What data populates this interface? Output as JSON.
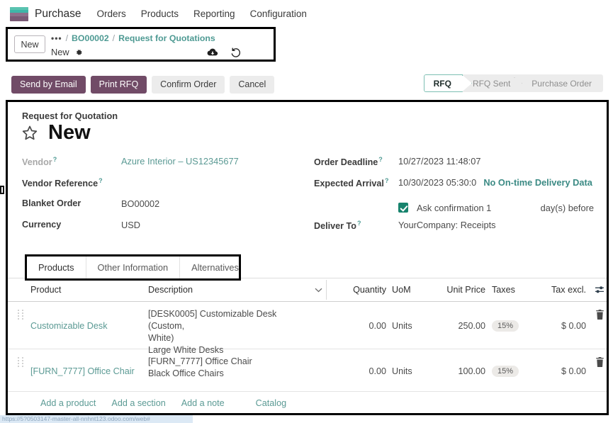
{
  "navbar": {
    "brand": "Purchase",
    "logo_icon": "purchase-app-logo-icon",
    "menus": [
      "Orders",
      "Products",
      "Reporting",
      "Configuration"
    ]
  },
  "breadcrumb": {
    "new_button": "New",
    "dots": "•••",
    "separator": "/",
    "parent_link": "BO00002",
    "current_link": "Request for Quotations",
    "record_state": "New",
    "gear_icon": "gear-icon",
    "save_icon": "cloud-save-icon",
    "discard_icon": "discard-undo-icon"
  },
  "action_buttons": [
    {
      "label": "Send by Email",
      "style": "primary"
    },
    {
      "label": "Print RFQ",
      "style": "primary"
    },
    {
      "label": "Confirm Order",
      "style": "secondary"
    },
    {
      "label": "Cancel",
      "style": "secondary"
    }
  ],
  "pipeline": {
    "steps": [
      "RFQ",
      "RFQ Sent",
      "Purchase Order"
    ],
    "active": "RFQ",
    "active_color": "#7dbfb3"
  },
  "form": {
    "subtitle": "Request for Quotation",
    "title": "New",
    "star_icon": "favorite-star-icon",
    "left_fields": [
      {
        "label": "Vendor",
        "help": "?",
        "value": "Azure Interior – US12345677",
        "kind": "link",
        "muted_label": true
      },
      {
        "label": "Vendor Reference",
        "help": "?",
        "value": "",
        "kind": "text",
        "muted_label": false
      },
      {
        "label": "Blanket Order",
        "help": "",
        "value": "BO00002",
        "kind": "text",
        "muted_label": false
      },
      {
        "label": "Currency",
        "help": "",
        "value": "USD",
        "kind": "text",
        "muted_label": false
      }
    ],
    "right_fields": [
      {
        "label": "Order Deadline",
        "help": "?",
        "value": "10/27/2023 11:48:07",
        "kind": "text"
      },
      {
        "label": "Expected Arrival",
        "help": "?",
        "value": "10/30/2023 05:30:0",
        "kind": "text",
        "extra_link": "No On-time Delivery Data"
      },
      {
        "label": "Deliver To",
        "help": "?",
        "value": "YourCompany: Receipts",
        "kind": "text"
      }
    ],
    "ask_confirmation": {
      "checked": true,
      "label": "Ask confirmation 1",
      "suffix": "day(s) before",
      "checkbox_color": "#17836d"
    }
  },
  "tabs": [
    {
      "label": "Products",
      "active": true
    },
    {
      "label": "Other Information",
      "active": false
    },
    {
      "label": "Alternatives",
      "active": false
    }
  ],
  "order_lines": {
    "columns": {
      "product": "Product",
      "description": "Description",
      "quantity": "Quantity",
      "uom": "UoM",
      "unit_price": "Unit Price",
      "taxes": "Taxes",
      "tax_excl": "Tax excl.",
      "caret_icon": "chevron-down-icon",
      "settings_icon": "column-options-sliders-icon"
    },
    "rows": [
      {
        "product": "Customizable Desk",
        "description_line1": "[DESK0005] Customizable Desk (Custom,",
        "description_line2": "White)",
        "description_line3": "Large White Desks",
        "quantity": "0.00",
        "uom": "Units",
        "unit_price": "250.00",
        "taxes": "15%",
        "tax_excl": "$ 0.00",
        "delete_icon": "trash-icon",
        "drag_icon": "drag-handle-icon"
      },
      {
        "product": "[FURN_7777] Office Chair",
        "description_line1": "[FURN_7777] Office Chair",
        "description_line2": "Black Office Chairs",
        "description_line3": "",
        "quantity": "0.00",
        "uom": "Units",
        "unit_price": "100.00",
        "taxes": "15%",
        "tax_excl": "$ 0.00",
        "delete_icon": "trash-icon",
        "drag_icon": "drag-handle-icon"
      }
    ],
    "add_links": [
      "Add a product",
      "Add a section",
      "Add a note"
    ],
    "catalog_link": "Catalog"
  },
  "status_bar": {
    "url_preview": "https://5?0503147-master-all-nnhnt123.odoo.com/web#"
  }
}
